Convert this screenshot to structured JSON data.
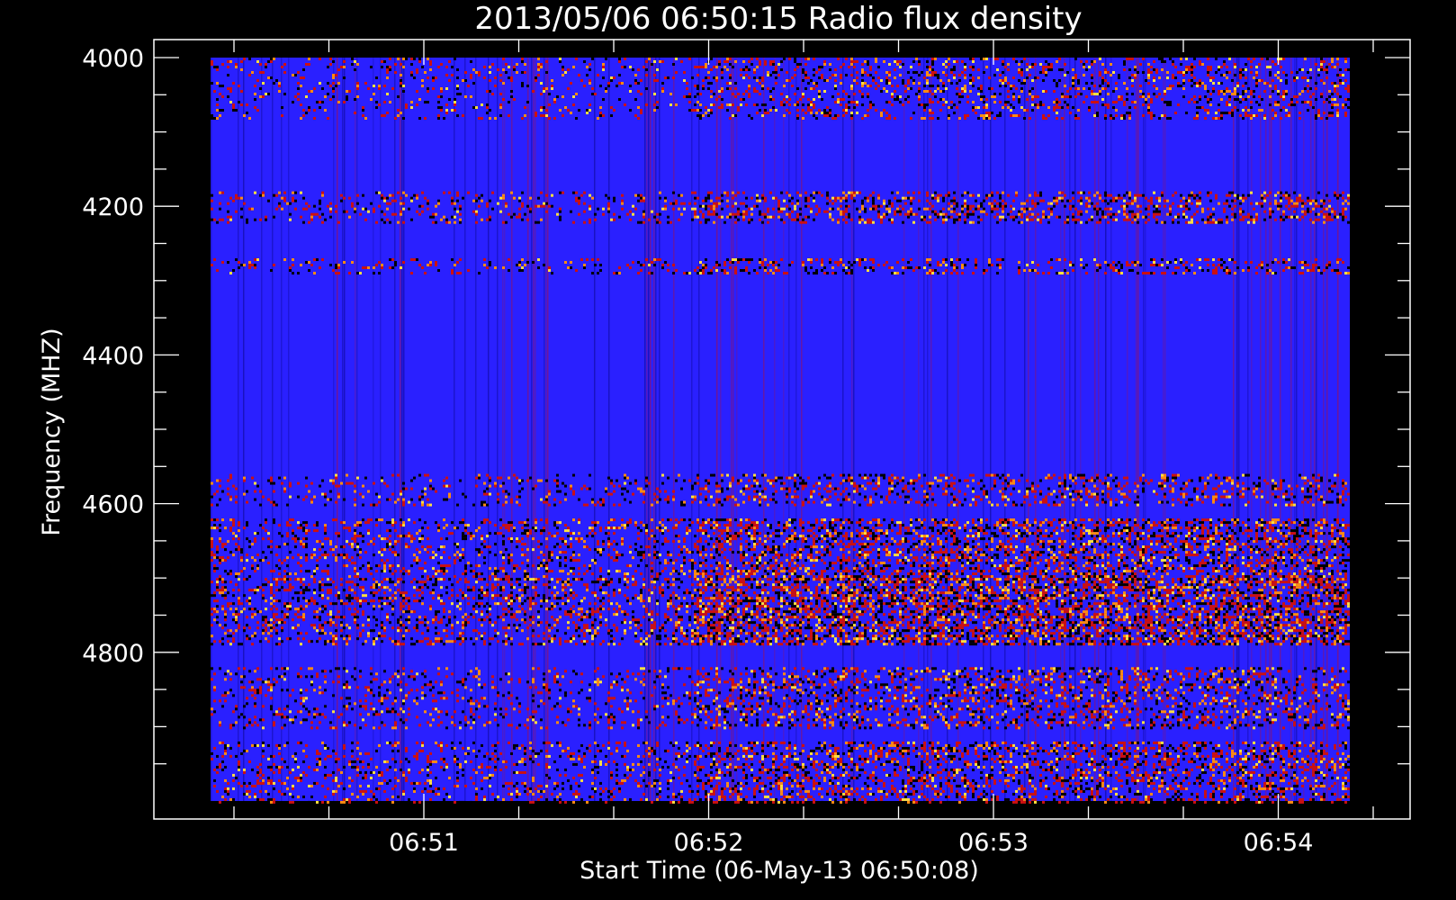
{
  "chart_data": {
    "type": "heatmap",
    "title": "2013/05/06 06:50:15 Radio flux density",
    "xlabel": "Start Time (06-May-13 06:50:08)",
    "ylabel": "Frequency (MHZ)",
    "x_ticks": [
      "06:51",
      "06:52",
      "06:53",
      "06:54"
    ],
    "y_ticks": [
      "4000",
      "4200",
      "4400",
      "4600",
      "4800"
    ],
    "ylim": [
      4000,
      5000
    ],
    "y_inverted": true,
    "colormap": [
      "#000000",
      "#1a10ff",
      "#cc1010",
      "#ff8c10",
      "#ffe040"
    ],
    "background_color": "#2a20ff",
    "hot_bands": [
      {
        "freq_start": 4000,
        "freq_end": 4080,
        "intensity": 0.4
      },
      {
        "freq_start": 4180,
        "freq_end": 4220,
        "intensity": 0.55
      },
      {
        "freq_start": 4270,
        "freq_end": 4290,
        "intensity": 0.45
      },
      {
        "freq_start": 4560,
        "freq_end": 4600,
        "intensity": 0.45
      },
      {
        "freq_start": 4620,
        "freq_end": 4700,
        "intensity": 0.7
      },
      {
        "freq_start": 4700,
        "freq_end": 4790,
        "intensity": 0.9
      },
      {
        "freq_start": 4820,
        "freq_end": 4900,
        "intensity": 0.5
      },
      {
        "freq_start": 4920,
        "freq_end": 5000,
        "intensity": 0.6
      }
    ]
  }
}
